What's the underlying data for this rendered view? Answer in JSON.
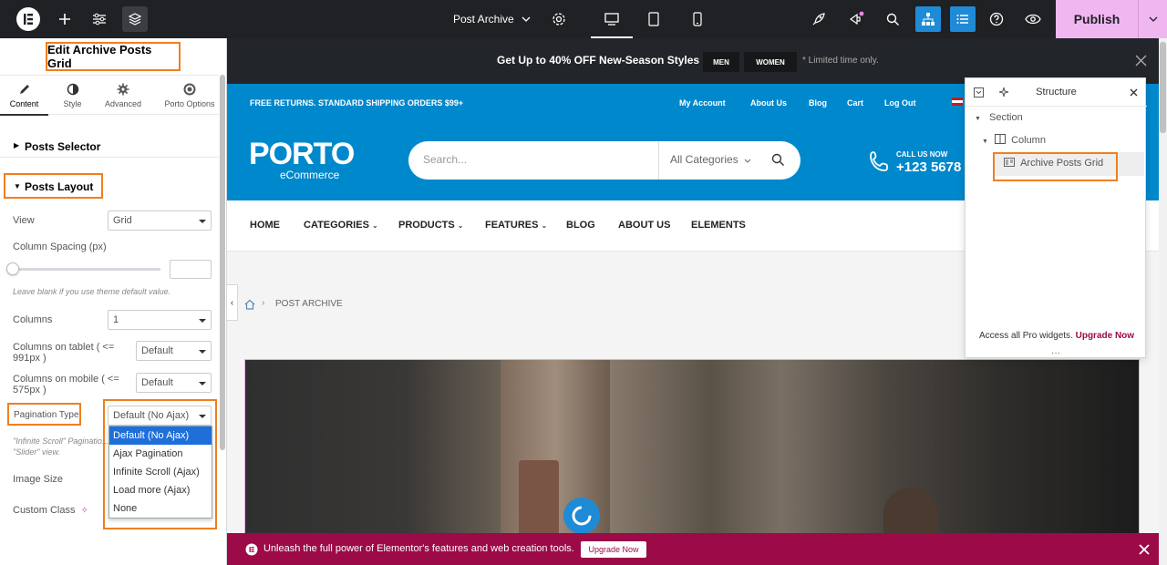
{
  "topbar": {
    "page_name": "Post Archive",
    "publish_label": "Publish"
  },
  "panel": {
    "title": "Edit Archive Posts Grid",
    "tabs": [
      {
        "label": "Content",
        "icon": "pencil-icon"
      },
      {
        "label": "Style",
        "icon": "contrast-icon"
      },
      {
        "label": "Advanced",
        "icon": "gear-icon"
      },
      {
        "label": "Porto Options",
        "icon": "circle-icon"
      }
    ],
    "posts_selector": "Posts Selector",
    "posts_layout": "Posts Layout",
    "view_label": "View",
    "view_value": "Grid",
    "column_spacing_label": "Column Spacing (px)",
    "column_spacing_hint": "Leave blank if you use theme default value.",
    "columns_label": "Columns",
    "columns_value": "1",
    "columns_tablet_label": "Columns on tablet ( <= 991px )",
    "columns_tablet_value": "Default",
    "columns_mobile_label": "Columns on mobile ( <= 575px )",
    "columns_mobile_value": "Default",
    "pagination_label": "Pagination Type",
    "pagination_value": "Default (No Ajax)",
    "pagination_hint": "\"Infinite Scroll\" Paginatio... \"Slider\" view.",
    "pagination_options": [
      "Default (No Ajax)",
      "Ajax Pagination",
      "Infinite Scroll (Ajax)",
      "Load more (Ajax)",
      "None"
    ],
    "image_size_label": "Image Size",
    "custom_class_label": "Custom Class"
  },
  "preview": {
    "promo_prefix": "Get Up to ",
    "promo_bold": "40% OFF",
    "promo_suffix": " New-Season Styles",
    "promo_men": "MEN",
    "promo_women": "WOMEN",
    "promo_note": "* Limited time only.",
    "free_returns": "FREE RETURNS. STANDARD SHIPPING ORDERS $99+",
    "header_links": [
      "My Account",
      "About Us",
      "Blog",
      "Cart",
      "Log Out"
    ],
    "logo": "PORTO",
    "logo_sub": "eCommerce",
    "search_placeholder": "Search...",
    "search_category": "All Categories",
    "call_label": "CALL US NOW",
    "call_number": "+123 5678",
    "nav": [
      "HOME",
      "CATEGORIES",
      "PRODUCTS",
      "FEATURES",
      "BLOG",
      "ABOUT US",
      "ELEMENTS"
    ],
    "breadcrumb": "POST ARCHIVE",
    "notice_text": "Unleash the full power of Elementor's features and web creation tools.",
    "notice_button": "Upgrade Now"
  },
  "structure": {
    "title": "Structure",
    "section": "Section",
    "column": "Column",
    "widget": "Archive Posts Grid",
    "upsell_text": "Access all Pro widgets.",
    "upsell_link": "Upgrade Now"
  },
  "colors": {
    "accent_pink": "#f0b6f0",
    "topbar": "#1f2124",
    "porto_blue": "#0088cc",
    "highlight_orange": "#f07f1f",
    "notice_bar": "#9c0a48"
  }
}
